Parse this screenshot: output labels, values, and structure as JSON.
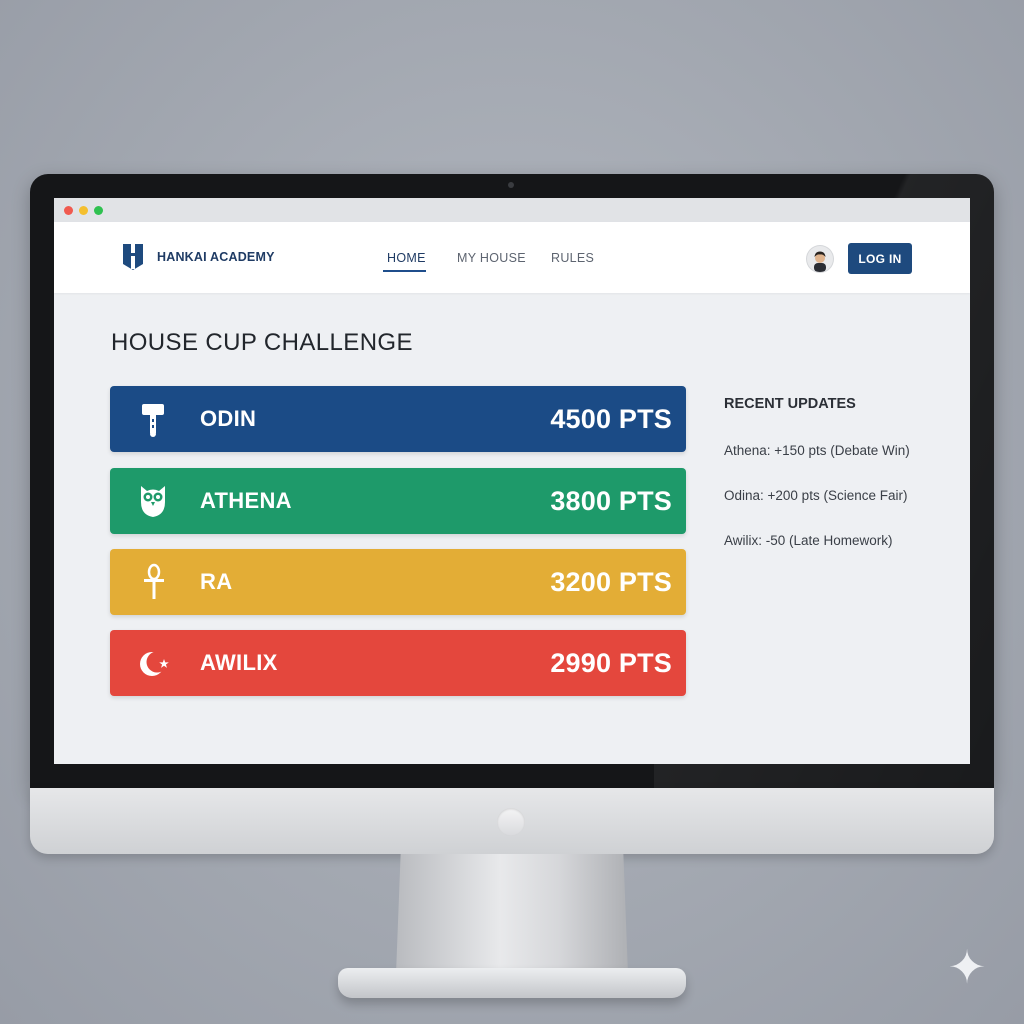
{
  "browser": {
    "dots": [
      {
        "name": "close",
        "color": "#f05a4f"
      },
      {
        "name": "minimize",
        "color": "#f4bf2e"
      },
      {
        "name": "maximize",
        "color": "#2fc150"
      }
    ]
  },
  "header": {
    "brand": "HANKAI ACADEMY",
    "logo_icon": "shield-h-icon",
    "nav": [
      {
        "label": "HOME",
        "active": true
      },
      {
        "label": "MY HOUSE",
        "active": false
      },
      {
        "label": "RULES",
        "active": false
      }
    ],
    "avatar_icon": "user-avatar-icon",
    "login_label": "LOG IN"
  },
  "main": {
    "title": "HOUSE CUP CHALLENGE",
    "houses": [
      {
        "name": "ODIN",
        "points": "4500 PTS",
        "color": "#1b4b86",
        "icon": "hammer-icon"
      },
      {
        "name": "ATHENA",
        "points": "3800 PTS",
        "color": "#1e9a6a",
        "icon": "owl-icon"
      },
      {
        "name": "RA",
        "points": "3200 PTS",
        "color": "#e3ad36",
        "icon": "ankh-icon"
      },
      {
        "name": "AWILIX",
        "points": "2990 PTS",
        "color": "#e4473d",
        "icon": "moon-star-icon"
      }
    ]
  },
  "sidebar": {
    "title": "RECENT UPDATES",
    "updates": [
      "Athena: +150 pts (Debate Win)",
      "Odina: +200 pts (Science Fair)",
      "Awilix:  -50 (Late Homework)"
    ]
  },
  "colors": {
    "primary": "#1e4a7e",
    "brand_text": "#1f3b64"
  }
}
